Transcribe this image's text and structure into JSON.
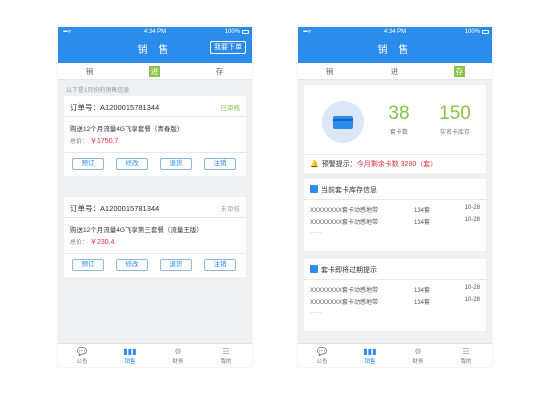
{
  "status": {
    "time": "4:34 PM",
    "battery": "100%",
    "signal": "••••• ᯤ"
  },
  "left": {
    "title": "销 售",
    "nav_button": "我要下单",
    "tabs": [
      "销",
      "进",
      "存"
    ],
    "hint": "以下是1月份的销售信息",
    "orders": [
      {
        "order_no": "订单号：A1200015781344",
        "status": "已审核",
        "status_color": "#8bc34a",
        "product": "购送12个月流量4G飞享套餐（青春版）",
        "total_label": "总价：",
        "price": "￥1750.7",
        "actions": [
          "预订",
          "修改",
          "退货",
          "注销"
        ]
      },
      {
        "order_no": "订单号：A1200015781344",
        "status": "未审核",
        "status_color": "#aaaaaa",
        "product": "购送12个月流量4G飞享第三套餐（流量王版）",
        "total_label": "总价：",
        "price": "￥230.4",
        "actions": [
          "预订",
          "修改",
          "退货",
          "注销"
        ]
      }
    ],
    "bottom": [
      {
        "icon": "💬",
        "label": "公告"
      },
      {
        "icon": "▮▮▮",
        "label": "销售"
      },
      {
        "icon": "⚙",
        "label": "财务"
      },
      {
        "icon": "☰",
        "label": "我的"
      }
    ]
  },
  "right": {
    "title": "销 售",
    "tabs": [
      "销",
      "进",
      "存"
    ],
    "stats": [
      {
        "value": "38",
        "label": "套卡数"
      },
      {
        "value": "150",
        "label": "实名卡库存"
      }
    ],
    "alert": {
      "prefix": "预警提示：",
      "text": "今月剩余卡数 3280（套）"
    },
    "sections": [
      {
        "title": "当前套卡库存信息",
        "rows": [
          {
            "name": "XXXXXXXX套卡动感地带",
            "qty": "134套",
            "date": "10-28"
          },
          {
            "name": "XXXXXXXX套卡动感地带",
            "qty": "134套",
            "date": "10-28"
          }
        ],
        "more": "……"
      },
      {
        "title": "套卡即将过期提示",
        "rows": [
          {
            "name": "XXXXXXXX套卡动感地带",
            "qty": "134套",
            "date": "10-28"
          },
          {
            "name": "XXXXXXXX套卡动感地带",
            "qty": "134套",
            "date": "10-28"
          }
        ],
        "more": "……"
      }
    ],
    "bottom": [
      {
        "icon": "💬",
        "label": "公告"
      },
      {
        "icon": "▮▮▮",
        "label": "销售"
      },
      {
        "icon": "⚙",
        "label": "财务"
      },
      {
        "icon": "☰",
        "label": "我的"
      }
    ]
  },
  "colors": {
    "primary": "#2b8ceb",
    "accent_green": "#8bc34a",
    "price_red": "#e0303f"
  }
}
